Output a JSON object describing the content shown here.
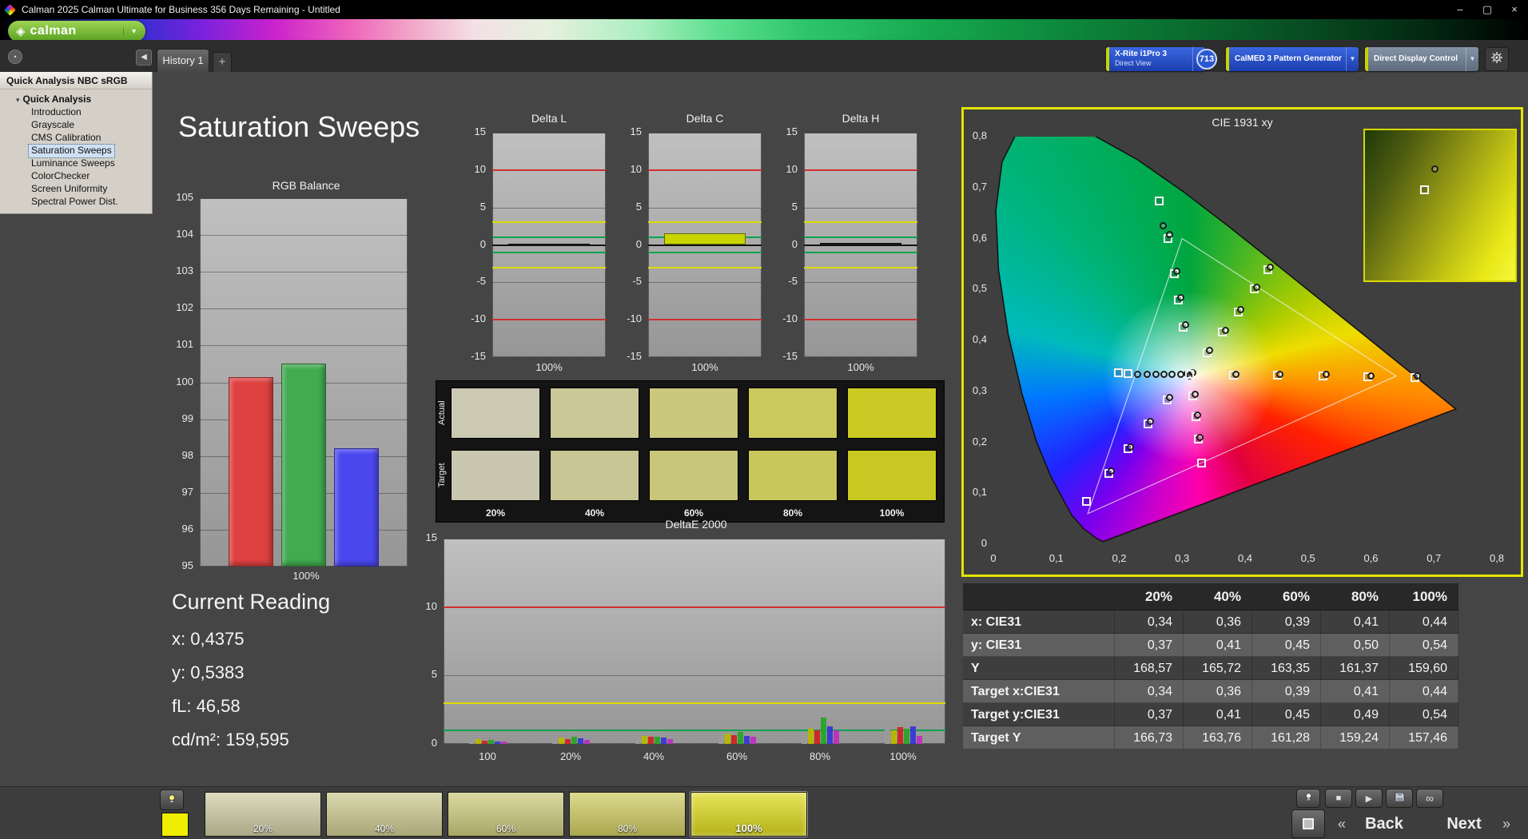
{
  "window": {
    "title": "Calman 2025 Calman Ultimate for Business 356 Days Remaining  - Untitled",
    "controls": {
      "minimize": "–",
      "maximize": "▢",
      "close": "×"
    }
  },
  "logo": {
    "text": "calman"
  },
  "tab_bar": {
    "tabs": [
      {
        "label": "History 1"
      }
    ],
    "add_label": "+"
  },
  "toolbar": {
    "meter": {
      "line1": "X-Rite i1Pro 3",
      "line2": "Direct View"
    },
    "badge": "713",
    "pattern_generator": "CalMED 3 Pattern Generator",
    "display_control": "Direct Display Control"
  },
  "sidebar": {
    "header": "Quick Analysis NBC sRGB",
    "tree": {
      "root": "Quick Analysis",
      "items": [
        {
          "label": "Introduction",
          "selected": false
        },
        {
          "label": "Grayscale",
          "selected": false
        },
        {
          "label": "CMS Calibration",
          "selected": false
        },
        {
          "label": "Saturation Sweeps",
          "selected": true
        },
        {
          "label": "Luminance Sweeps",
          "selected": false
        },
        {
          "label": "ColorChecker",
          "selected": false
        },
        {
          "label": "Screen Uniformity",
          "selected": false
        },
        {
          "label": "Spectral Power Dist.",
          "selected": false
        }
      ]
    }
  },
  "page": {
    "title": "Saturation Sweeps"
  },
  "current_reading": {
    "title": "Current Reading",
    "lines": [
      "x: 0,4375",
      "y: 0,5383",
      "fL: 46,58",
      "cd/m²: 159,595"
    ]
  },
  "swatch_panel": {
    "row_labels": [
      "Actual",
      "Target"
    ],
    "columns": [
      "20%",
      "40%",
      "60%",
      "80%",
      "100%"
    ],
    "actual_colors": [
      "#cbc9b2",
      "#cac897",
      "#c9c87b",
      "#cac95c",
      "#cbca25"
    ],
    "target_colors": [
      "#c9c7b0",
      "#c8c695",
      "#c7c67a",
      "#c8c75b",
      "#c9c823"
    ]
  },
  "chart_data": [
    {
      "id": "rgb_balance",
      "type": "bar",
      "title": "RGB Balance",
      "categories": [
        "100%"
      ],
      "series": [
        {
          "name": "Red",
          "color": "#df4040",
          "values": [
            100.15
          ]
        },
        {
          "name": "Green",
          "color": "#41ab50",
          "values": [
            100.5
          ]
        },
        {
          "name": "Blue",
          "color": "#4b47ef",
          "values": [
            98.2
          ]
        }
      ],
      "ylim": [
        95,
        105
      ],
      "yticks": [
        105,
        104,
        103,
        102,
        101,
        100,
        99,
        98,
        97,
        96,
        95
      ],
      "xlabel": "100%"
    },
    {
      "id": "delta_l",
      "type": "bar",
      "title": "Delta L",
      "categories": [
        "100%"
      ],
      "values": [
        0.2
      ],
      "bar_color": "#1d1d1d",
      "ylim": [
        -15,
        15
      ],
      "yticks": [
        15,
        10,
        5,
        0,
        -5,
        -10,
        -15
      ],
      "reference_lines": [
        {
          "y": 10,
          "color": "#d22f2f"
        },
        {
          "y": -10,
          "color": "#d22f2f"
        },
        {
          "y": 3,
          "color": "#dcdc00"
        },
        {
          "y": -3,
          "color": "#dcdc00"
        },
        {
          "y": 1,
          "color": "#00a44e"
        },
        {
          "y": -1,
          "color": "#00a44e"
        }
      ],
      "xlabel": "100%"
    },
    {
      "id": "delta_c",
      "type": "bar",
      "title": "Delta C",
      "categories": [
        "100%"
      ],
      "values": [
        1.6
      ],
      "bar_color": "#c9d400",
      "ylim": [
        -15,
        15
      ],
      "yticks": [
        15,
        10,
        5,
        0,
        -5,
        -10,
        -15
      ],
      "reference_lines": [
        {
          "y": 10,
          "color": "#d22f2f"
        },
        {
          "y": -10,
          "color": "#d22f2f"
        },
        {
          "y": 3,
          "color": "#dcdc00"
        },
        {
          "y": -3,
          "color": "#dcdc00"
        },
        {
          "y": 1,
          "color": "#00a44e"
        },
        {
          "y": -1,
          "color": "#00a44e"
        }
      ],
      "xlabel": "100%"
    },
    {
      "id": "delta_h",
      "type": "bar",
      "title": "Delta H",
      "categories": [
        "100%"
      ],
      "values": [
        0.3
      ],
      "bar_color": "#1d1d1d",
      "ylim": [
        -15,
        15
      ],
      "yticks": [
        15,
        10,
        5,
        0,
        -5,
        -10,
        -15
      ],
      "reference_lines": [
        {
          "y": 10,
          "color": "#d22f2f"
        },
        {
          "y": -10,
          "color": "#d22f2f"
        },
        {
          "y": 3,
          "color": "#dcdc00"
        },
        {
          "y": -3,
          "color": "#dcdc00"
        },
        {
          "y": 1,
          "color": "#00a44e"
        },
        {
          "y": -1,
          "color": "#00a44e"
        }
      ],
      "xlabel": "100%"
    },
    {
      "id": "delta_e2000",
      "type": "bar",
      "title": "DeltaE 2000",
      "categories": [
        "100",
        "20%",
        "40%",
        "60%",
        "80%",
        "100%"
      ],
      "series_colors": [
        "#9a9a9a",
        "#b6b600",
        "#cc2929",
        "#2da52d",
        "#3c3cd2",
        "#b935b9"
      ],
      "groups": [
        [
          0.2,
          0.35,
          0.25,
          0.3,
          0.2,
          0.15
        ],
        [
          0.3,
          0.45,
          0.35,
          0.5,
          0.4,
          0.3
        ],
        [
          0.45,
          0.6,
          0.5,
          0.55,
          0.45,
          0.35
        ],
        [
          0.55,
          0.75,
          0.65,
          0.9,
          0.6,
          0.5
        ],
        [
          0.9,
          1.1,
          1.0,
          1.9,
          1.3,
          1.0
        ],
        [
          1.4,
          1.0,
          1.2,
          1.1,
          1.3,
          0.6
        ]
      ],
      "ylim": [
        0,
        15
      ],
      "yticks": [
        15,
        10,
        5,
        0
      ],
      "reference_lines": [
        {
          "y": 10,
          "color": "#d22f2f"
        },
        {
          "y": 3,
          "color": "#dcdc00"
        },
        {
          "y": 1,
          "color": "#00a44e"
        }
      ]
    },
    {
      "id": "cie_1931",
      "type": "scatter",
      "title": "CIE 1931 xy",
      "xlim": [
        0,
        0.8
      ],
      "ylim": [
        0,
        0.8
      ],
      "xtick_labels": [
        "0",
        "0,1",
        "0,2",
        "0,3",
        "0,4",
        "0,5",
        "0,6",
        "0,7",
        "0,8"
      ],
      "ytick_labels": [
        "0",
        "0,1",
        "0,2",
        "0,3",
        "0,4",
        "0,5",
        "0,6",
        "0,7",
        "0,8"
      ],
      "points": [
        [
          0.34,
          0.375,
          "s"
        ],
        [
          0.365,
          0.415,
          "s"
        ],
        [
          0.39,
          0.455,
          "s"
        ],
        [
          0.415,
          0.5,
          "s"
        ],
        [
          0.437,
          0.538,
          "s"
        ],
        [
          0.344,
          0.379,
          "c"
        ],
        [
          0.369,
          0.419,
          "c"
        ],
        [
          0.394,
          0.459,
          "c"
        ],
        [
          0.419,
          0.504,
          "c"
        ],
        [
          0.441,
          0.542,
          "c"
        ],
        [
          0.302,
          0.425,
          "s"
        ],
        [
          0.295,
          0.478,
          "s"
        ],
        [
          0.288,
          0.53,
          "s"
        ],
        [
          0.278,
          0.6,
          "s"
        ],
        [
          0.264,
          0.673,
          "s"
        ],
        [
          0.306,
          0.43,
          "c"
        ],
        [
          0.299,
          0.483,
          "c"
        ],
        [
          0.292,
          0.535,
          "c"
        ],
        [
          0.281,
          0.607,
          "c"
        ],
        [
          0.271,
          0.625,
          "c"
        ],
        [
          0.382,
          0.331,
          "s"
        ],
        [
          0.452,
          0.331,
          "s"
        ],
        [
          0.525,
          0.33,
          "s"
        ],
        [
          0.596,
          0.328,
          "s"
        ],
        [
          0.67,
          0.327,
          "s"
        ],
        [
          0.386,
          0.333,
          "c"
        ],
        [
          0.456,
          0.333,
          "c"
        ],
        [
          0.529,
          0.332,
          "c"
        ],
        [
          0.6,
          0.33,
          "c"
        ],
        [
          0.674,
          0.329,
          "c"
        ],
        [
          0.298,
          0.332,
          "c"
        ],
        [
          0.285,
          0.332,
          "c"
        ],
        [
          0.272,
          0.332,
          "c"
        ],
        [
          0.259,
          0.332,
          "c"
        ],
        [
          0.245,
          0.333,
          "c"
        ],
        [
          0.23,
          0.333,
          "c"
        ],
        [
          0.214,
          0.334,
          "s"
        ],
        [
          0.199,
          0.335,
          "s"
        ],
        [
          0.277,
          0.283,
          "s"
        ],
        [
          0.246,
          0.235,
          "s"
        ],
        [
          0.214,
          0.186,
          "s"
        ],
        [
          0.184,
          0.138,
          "s"
        ],
        [
          0.148,
          0.083,
          "s"
        ],
        [
          0.28,
          0.287,
          "c"
        ],
        [
          0.25,
          0.24,
          "c"
        ],
        [
          0.218,
          0.19,
          "c"
        ],
        [
          0.188,
          0.142,
          "c"
        ],
        [
          0.318,
          0.29,
          "s"
        ],
        [
          0.322,
          0.25,
          "s"
        ],
        [
          0.326,
          0.205,
          "s"
        ],
        [
          0.331,
          0.158,
          "s"
        ],
        [
          0.321,
          0.293,
          "c"
        ],
        [
          0.325,
          0.253,
          "c"
        ],
        [
          0.329,
          0.208,
          "c"
        ],
        [
          0.308,
          0.334,
          "c"
        ],
        [
          0.313,
          0.33,
          "c"
        ],
        [
          0.317,
          0.336,
          "c"
        ],
        [
          0.312,
          0.333,
          "s"
        ]
      ],
      "inset_points": [
        [
          0.47,
          0.26,
          "c"
        ],
        [
          0.4,
          0.4,
          "s"
        ]
      ]
    }
  ],
  "results_table": {
    "columns": [
      "20%",
      "40%",
      "60%",
      "80%",
      "100%"
    ],
    "rows": [
      {
        "label": "x: CIE31",
        "values": [
          "0,34",
          "0,36",
          "0,39",
          "0,41",
          "0,44"
        ]
      },
      {
        "label": "y: CIE31",
        "values": [
          "0,37",
          "0,41",
          "0,45",
          "0,50",
          "0,54"
        ]
      },
      {
        "label": "Y",
        "values": [
          "168,57",
          "165,72",
          "163,35",
          "161,37",
          "159,60"
        ]
      },
      {
        "label": "Target x:CIE31",
        "values": [
          "0,34",
          "0,36",
          "0,39",
          "0,41",
          "0,44"
        ]
      },
      {
        "label": "Target y:CIE31",
        "values": [
          "0,37",
          "0,41",
          "0,45",
          "0,49",
          "0,54"
        ]
      },
      {
        "label": "Target Y",
        "values": [
          "166,73",
          "163,76",
          "161,28",
          "159,24",
          "157,46"
        ]
      }
    ]
  },
  "bottom_bar": {
    "active_patch_color": "#f0ee00",
    "patches": [
      {
        "label": "20%",
        "color": "#cfcda4",
        "selected": false
      },
      {
        "label": "40%",
        "color": "#cecb92",
        "selected": false
      },
      {
        "label": "60%",
        "color": "#cdcb7d",
        "selected": false
      },
      {
        "label": "80%",
        "color": "#cfcc62",
        "selected": false
      },
      {
        "label": "100%",
        "color": "#dcd91c",
        "selected": true
      }
    ],
    "prev_chevron": "«",
    "back_label": "Back",
    "next_label": "Next",
    "next_chevron": "»"
  }
}
